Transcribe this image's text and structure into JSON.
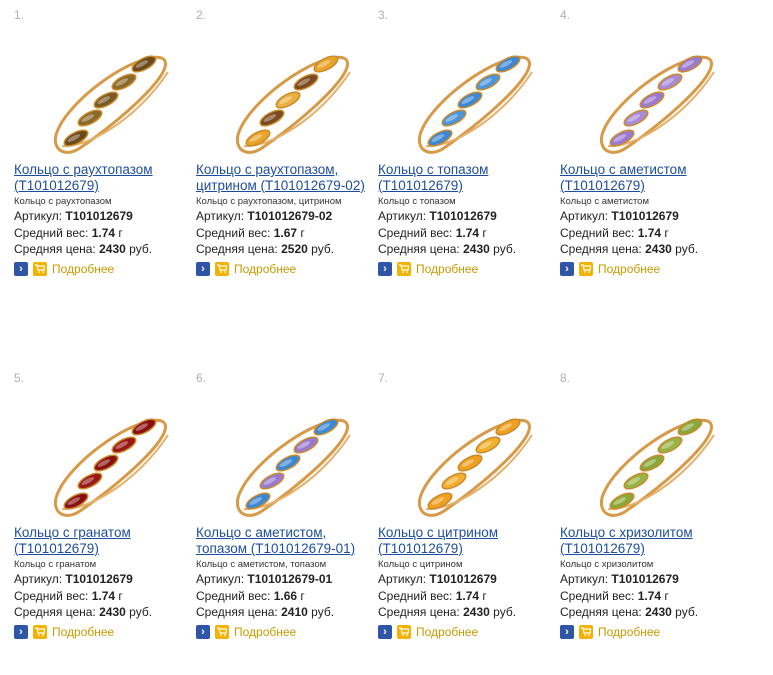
{
  "products": [
    {
      "num": "1.",
      "title": "Кольцо с раухтопазом (T101012679)",
      "subtitle": "Кольцо с раухтопазом",
      "article_label": "Артикул:",
      "article": "T101012679",
      "weight_label": "Средний вес:",
      "weight": "1.74",
      "weight_unit": "г",
      "price_label": "Средняя цена:",
      "price": "2430",
      "price_unit": "руб.",
      "more": "Подробнее",
      "colors": [
        "#6b4a1e",
        "#8a6a2a",
        "#7a5a25",
        "#8a6a2a",
        "#6b4a1e"
      ]
    },
    {
      "num": "2.",
      "title": "Кольцо с раухтопазом, цитрином (T101012679-02)",
      "subtitle": "Кольцо с раухтопазом, цитрином",
      "article_label": "Артикул:",
      "article": "T101012679-02",
      "weight_label": "Средний вес:",
      "weight": "1.67",
      "weight_unit": "г",
      "price_label": "Средняя цена:",
      "price": "2520",
      "price_unit": "руб.",
      "more": "Подробнее",
      "colors": [
        "#e8a52a",
        "#7a4a20",
        "#eab040",
        "#7a4a20",
        "#e8a52a"
      ]
    },
    {
      "num": "3.",
      "title": "Кольцо с топазом (T101012679)",
      "subtitle": "Кольцо с топазом",
      "article_label": "Артикул:",
      "article": "T101012679",
      "weight_label": "Средний вес:",
      "weight": "1.74",
      "weight_unit": "г",
      "price_label": "Средняя цена:",
      "price": "2430",
      "price_unit": "руб.",
      "more": "Подробнее",
      "colors": [
        "#3d88d4",
        "#4a95dc",
        "#3d88d4",
        "#4a95dc",
        "#3d88d4"
      ]
    },
    {
      "num": "4.",
      "title": "Кольцо с аметистом (T101012679)",
      "subtitle": "Кольцо с аметистом",
      "article_label": "Артикул:",
      "article": "T101012679",
      "weight_label": "Средний вес:",
      "weight": "1.74",
      "weight_unit": "г",
      "price_label": "Средняя цена:",
      "price": "2430",
      "price_unit": "руб.",
      "more": "Подробнее",
      "colors": [
        "#9a7ad0",
        "#a88ad8",
        "#9a7ad0",
        "#a88ad8",
        "#9a7ad0"
      ]
    },
    {
      "num": "5.",
      "title": "Кольцо с гранатом (T101012679)",
      "subtitle": "Кольцо с гранатом",
      "article_label": "Артикул:",
      "article": "T101012679",
      "weight_label": "Средний вес:",
      "weight": "1.74",
      "weight_unit": "г",
      "price_label": "Средняя цена:",
      "price": "2430",
      "price_unit": "руб.",
      "more": "Подробнее",
      "colors": [
        "#8a1010",
        "#9a1818",
        "#8a1010",
        "#9a1818",
        "#8a1010"
      ]
    },
    {
      "num": "6.",
      "title": "Кольцо с аметистом, топазом (T101012679-01)",
      "subtitle": "Кольцо с аметистом, топазом",
      "article_label": "Артикул:",
      "article": "T101012679-01",
      "weight_label": "Средний вес:",
      "weight": "1.66",
      "weight_unit": "г",
      "price_label": "Средняя цена:",
      "price": "2410",
      "price_unit": "руб.",
      "more": "Подробнее",
      "colors": [
        "#3d88d4",
        "#9a7ad0",
        "#3d88d4",
        "#9a7ad0",
        "#3d88d4"
      ]
    },
    {
      "num": "7.",
      "title": "Кольцо с цитрином (T101012679)",
      "subtitle": "Кольцо с цитрином",
      "article_label": "Артикул:",
      "article": "T101012679",
      "weight_label": "Средний вес:",
      "weight": "1.74",
      "weight_unit": "г",
      "price_label": "Средняя цена:",
      "price": "2430",
      "price_unit": "руб.",
      "more": "Подробнее",
      "colors": [
        "#f0a020",
        "#f2b030",
        "#f0a020",
        "#f2b030",
        "#f0a020"
      ]
    },
    {
      "num": "8.",
      "title": "Кольцо с хризолитом (T101012679)",
      "subtitle": "Кольцо с хризолитом",
      "article_label": "Артикул:",
      "article": "T101012679",
      "weight_label": "Средний вес:",
      "weight": "1.74",
      "weight_unit": "г",
      "price_label": "Средняя цена:",
      "price": "2430",
      "price_unit": "руб.",
      "more": "Подробнее",
      "colors": [
        "#8aa83a",
        "#98b446",
        "#8aa83a",
        "#98b446",
        "#8aa83a"
      ]
    }
  ],
  "icons": {
    "arrow": "arrow-right-icon",
    "cart": "cart-icon"
  }
}
